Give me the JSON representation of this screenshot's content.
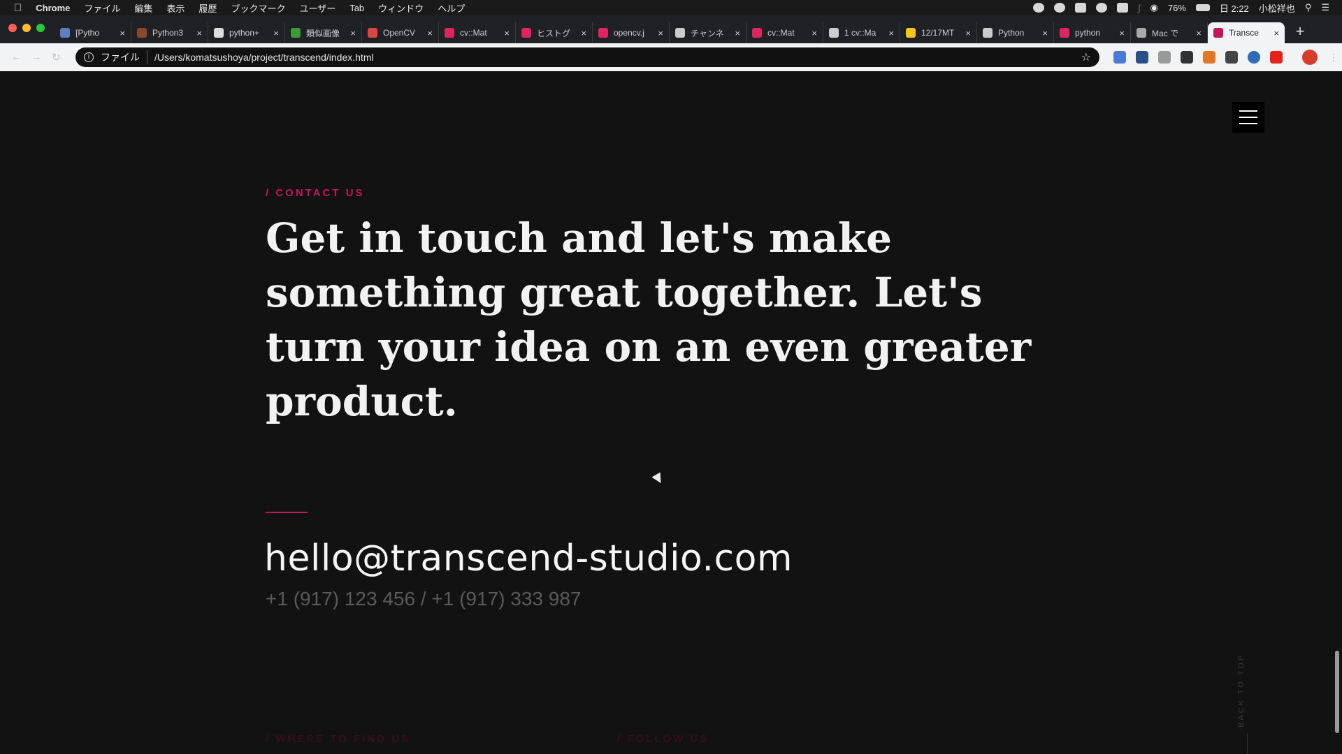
{
  "menubar": {
    "app": "Chrome",
    "menus": [
      "ファイル",
      "編集",
      "表示",
      "履歴",
      "ブックマーク",
      "ユーザー",
      "Tab",
      "ウィンドウ",
      "ヘルプ"
    ],
    "battery": "76%",
    "clock": "日 2:22",
    "user": "小松祥也"
  },
  "tabs": [
    {
      "title": "[Pytho",
      "fav_color": "#5b7fbf"
    },
    {
      "title": "Python3",
      "fav_color": "#8a4a2a"
    },
    {
      "title": "python+",
      "fav_color": "#dddddd"
    },
    {
      "title": "類似画像",
      "fav_color": "#3b9b3b"
    },
    {
      "title": "OpenCV",
      "fav_color": "#d44"
    },
    {
      "title": "cv::Mat",
      "fav_color": "#e0245e"
    },
    {
      "title": "ヒストグ",
      "fav_color": "#e0245e"
    },
    {
      "title": "opencv.j",
      "fav_color": "#e0245e"
    },
    {
      "title": "チャンネ",
      "fav_color": "#cccccc"
    },
    {
      "title": "cv::Mat",
      "fav_color": "#e0245e"
    },
    {
      "title": "1 cv::Ma",
      "fav_color": "#cccccc"
    },
    {
      "title": "12/17MT",
      "fav_color": "#f5c518"
    },
    {
      "title": "Python",
      "fav_color": "#cccccc"
    },
    {
      "title": "python",
      "fav_color": "#e0245e"
    },
    {
      "title": "Mac で",
      "fav_color": "#aaaaaa"
    },
    {
      "title": "Transce",
      "fav_color": "#c2185b",
      "active": true
    }
  ],
  "address": {
    "scheme_label": "ファイル",
    "url": "/Users/komatsushoya/project/transcend/index.html"
  },
  "content": {
    "eyebrow": "/ CONTACT US",
    "headline": "Get in touch and let's make something great together. Let's turn your idea on an even greater product.",
    "email": "hello@transcend-studio.com",
    "phones": "+1 (917) 123 456 / +1 (917) 333 987",
    "footer_left": "/ WHERE TO FIND US",
    "footer_right": "/ FOLLOW US",
    "back_to_top": "BACK TO TOP"
  },
  "colors": {
    "accent": "#c2185b",
    "background": "#121212"
  }
}
